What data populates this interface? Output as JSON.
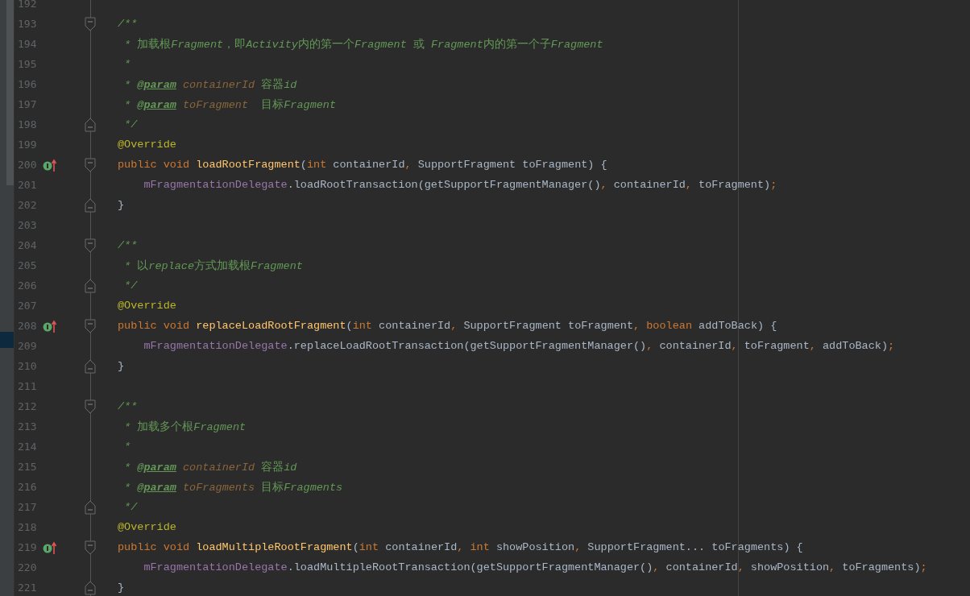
{
  "editor": {
    "lines": [
      {
        "number": "192",
        "fold_start": false,
        "fold_end": false,
        "override_marker": false
      },
      {
        "number": "193",
        "fold_start": true,
        "fold_end": false,
        "override_marker": false,
        "tokens": [
          {
            "text": "/**",
            "kind": "comment"
          }
        ]
      },
      {
        "number": "194",
        "fold_start": false,
        "fold_end": false,
        "override_marker": false,
        "tokens": [
          {
            "text": " * ",
            "kind": "comment"
          },
          {
            "text": "加载根",
            "kind": "cjk"
          },
          {
            "text": "Fragment",
            "kind": "comment"
          },
          {
            "text": "，即",
            "kind": "cjk"
          },
          {
            "text": "Activity",
            "kind": "comment"
          },
          {
            "text": "内的第一个",
            "kind": "cjk"
          },
          {
            "text": "Fragment",
            "kind": "comment"
          },
          {
            "text": " 或 ",
            "kind": "cjk"
          },
          {
            "text": "Fragment",
            "kind": "comment"
          },
          {
            "text": "内的第一个子",
            "kind": "cjk"
          },
          {
            "text": "Fragment",
            "kind": "comment"
          }
        ]
      },
      {
        "number": "195",
        "fold_start": false,
        "fold_end": false,
        "override_marker": false,
        "tokens": [
          {
            "text": " *",
            "kind": "comment"
          }
        ]
      },
      {
        "number": "196",
        "fold_start": false,
        "fold_end": false,
        "override_marker": false,
        "tokens": [
          {
            "text": " * ",
            "kind": "comment"
          },
          {
            "text": "@param",
            "kind": "tag"
          },
          {
            "text": " containerId ",
            "kind": "param"
          },
          {
            "text": "容器",
            "kind": "cjk"
          },
          {
            "text": "id",
            "kind": "comment"
          }
        ]
      },
      {
        "number": "197",
        "fold_start": false,
        "fold_end": false,
        "override_marker": false,
        "tokens": [
          {
            "text": " * ",
            "kind": "comment"
          },
          {
            "text": "@param",
            "kind": "tag"
          },
          {
            "text": " toFragment  ",
            "kind": "param"
          },
          {
            "text": "目标",
            "kind": "cjk"
          },
          {
            "text": "Fragment",
            "kind": "comment"
          }
        ]
      },
      {
        "number": "198",
        "fold_start": false,
        "fold_end": true,
        "override_marker": false,
        "tokens": [
          {
            "text": " */",
            "kind": "comment"
          }
        ]
      },
      {
        "number": "199",
        "fold_start": false,
        "fold_end": false,
        "override_marker": false,
        "tokens": [
          {
            "text": "@Override",
            "kind": "annotation"
          }
        ]
      },
      {
        "number": "200",
        "fold_start": true,
        "fold_end": false,
        "override_marker": true,
        "tokens": [
          {
            "text": "public void ",
            "kind": "keyword"
          },
          {
            "text": "loadRootFragment",
            "kind": "method"
          },
          {
            "text": "(",
            "kind": "plain"
          },
          {
            "text": "int",
            "kind": "keyword"
          },
          {
            "text": " containerId",
            "kind": "plain"
          },
          {
            "text": ",",
            "kind": "punct"
          },
          {
            "text": " SupportFragment toFragment) {",
            "kind": "plain"
          }
        ]
      },
      {
        "number": "201",
        "fold_start": false,
        "fold_end": false,
        "override_marker": false,
        "tokens": [
          {
            "text": "    mFragmentationDelegate",
            "kind": "field"
          },
          {
            "text": ".loadRootTransaction(getSupportFragmentManager()",
            "kind": "plain"
          },
          {
            "text": ",",
            "kind": "punct"
          },
          {
            "text": " containerId",
            "kind": "plain"
          },
          {
            "text": ",",
            "kind": "punct"
          },
          {
            "text": " toFragment)",
            "kind": "plain"
          },
          {
            "text": ";",
            "kind": "punct"
          }
        ]
      },
      {
        "number": "202",
        "fold_start": false,
        "fold_end": true,
        "override_marker": false,
        "tokens": [
          {
            "text": "}",
            "kind": "plain"
          }
        ]
      },
      {
        "number": "203",
        "fold_start": false,
        "fold_end": false,
        "override_marker": false
      },
      {
        "number": "204",
        "fold_start": true,
        "fold_end": false,
        "override_marker": false,
        "tokens": [
          {
            "text": "/**",
            "kind": "comment"
          }
        ]
      },
      {
        "number": "205",
        "fold_start": false,
        "fold_end": false,
        "override_marker": false,
        "tokens": [
          {
            "text": " * ",
            "kind": "comment"
          },
          {
            "text": "以",
            "kind": "cjk"
          },
          {
            "text": "replace",
            "kind": "comment"
          },
          {
            "text": "方式加载根",
            "kind": "cjk"
          },
          {
            "text": "Fragment",
            "kind": "comment"
          }
        ]
      },
      {
        "number": "206",
        "fold_start": false,
        "fold_end": true,
        "override_marker": false,
        "tokens": [
          {
            "text": " */",
            "kind": "comment"
          }
        ]
      },
      {
        "number": "207",
        "fold_start": false,
        "fold_end": false,
        "override_marker": false,
        "tokens": [
          {
            "text": "@Override",
            "kind": "annotation"
          }
        ]
      },
      {
        "number": "208",
        "fold_start": true,
        "fold_end": false,
        "override_marker": true,
        "tokens": [
          {
            "text": "public void ",
            "kind": "keyword"
          },
          {
            "text": "replaceLoadRootFragment",
            "kind": "method"
          },
          {
            "text": "(",
            "kind": "plain"
          },
          {
            "text": "int",
            "kind": "keyword"
          },
          {
            "text": " containerId",
            "kind": "plain"
          },
          {
            "text": ",",
            "kind": "punct"
          },
          {
            "text": " SupportFragment toFragment",
            "kind": "plain"
          },
          {
            "text": ",",
            "kind": "punct"
          },
          {
            "text": " boolean",
            "kind": "keyword"
          },
          {
            "text": " addToBack) {",
            "kind": "plain"
          }
        ]
      },
      {
        "number": "209",
        "fold_start": false,
        "fold_end": false,
        "override_marker": false,
        "tokens": [
          {
            "text": "    mFragmentationDelegate",
            "kind": "field"
          },
          {
            "text": ".replaceLoadRootTransaction(getSupportFragmentManager()",
            "kind": "plain"
          },
          {
            "text": ",",
            "kind": "punct"
          },
          {
            "text": " containerId",
            "kind": "plain"
          },
          {
            "text": ",",
            "kind": "punct"
          },
          {
            "text": " toFragment",
            "kind": "plain"
          },
          {
            "text": ",",
            "kind": "punct"
          },
          {
            "text": " addToBack)",
            "kind": "plain"
          },
          {
            "text": ";",
            "kind": "punct"
          }
        ]
      },
      {
        "number": "210",
        "fold_start": false,
        "fold_end": true,
        "override_marker": false,
        "tokens": [
          {
            "text": "}",
            "kind": "plain"
          }
        ]
      },
      {
        "number": "211",
        "fold_start": false,
        "fold_end": false,
        "override_marker": false
      },
      {
        "number": "212",
        "fold_start": true,
        "fold_end": false,
        "override_marker": false,
        "tokens": [
          {
            "text": "/**",
            "kind": "comment"
          }
        ]
      },
      {
        "number": "213",
        "fold_start": false,
        "fold_end": false,
        "override_marker": false,
        "tokens": [
          {
            "text": " * ",
            "kind": "comment"
          },
          {
            "text": "加载多个根",
            "kind": "cjk"
          },
          {
            "text": "Fragment",
            "kind": "comment"
          }
        ]
      },
      {
        "number": "214",
        "fold_start": false,
        "fold_end": false,
        "override_marker": false,
        "tokens": [
          {
            "text": " *",
            "kind": "comment"
          }
        ]
      },
      {
        "number": "215",
        "fold_start": false,
        "fold_end": false,
        "override_marker": false,
        "tokens": [
          {
            "text": " * ",
            "kind": "comment"
          },
          {
            "text": "@param",
            "kind": "tag"
          },
          {
            "text": " containerId ",
            "kind": "param"
          },
          {
            "text": "容器",
            "kind": "cjk"
          },
          {
            "text": "id",
            "kind": "comment"
          }
        ]
      },
      {
        "number": "216",
        "fold_start": false,
        "fold_end": false,
        "override_marker": false,
        "tokens": [
          {
            "text": " * ",
            "kind": "comment"
          },
          {
            "text": "@param",
            "kind": "tag"
          },
          {
            "text": " toFragments ",
            "kind": "param"
          },
          {
            "text": "目标",
            "kind": "cjk"
          },
          {
            "text": "Fragments",
            "kind": "comment"
          }
        ]
      },
      {
        "number": "217",
        "fold_start": false,
        "fold_end": true,
        "override_marker": false,
        "tokens": [
          {
            "text": " */",
            "kind": "comment"
          }
        ]
      },
      {
        "number": "218",
        "fold_start": false,
        "fold_end": false,
        "override_marker": false,
        "tokens": [
          {
            "text": "@Override",
            "kind": "annotation"
          }
        ]
      },
      {
        "number": "219",
        "fold_start": true,
        "fold_end": false,
        "override_marker": true,
        "tokens": [
          {
            "text": "public void ",
            "kind": "keyword"
          },
          {
            "text": "loadMultipleRootFragment",
            "kind": "method"
          },
          {
            "text": "(",
            "kind": "plain"
          },
          {
            "text": "int",
            "kind": "keyword"
          },
          {
            "text": " containerId",
            "kind": "plain"
          },
          {
            "text": ",",
            "kind": "punct"
          },
          {
            "text": " int",
            "kind": "keyword"
          },
          {
            "text": " showPosition",
            "kind": "plain"
          },
          {
            "text": ",",
            "kind": "punct"
          },
          {
            "text": " SupportFragment... toFragments) {",
            "kind": "plain"
          }
        ]
      },
      {
        "number": "220",
        "fold_start": false,
        "fold_end": false,
        "override_marker": false,
        "tokens": [
          {
            "text": "    mFragmentationDelegate",
            "kind": "field"
          },
          {
            "text": ".loadMultipleRootTransaction(getSupportFragmentManager()",
            "kind": "plain"
          },
          {
            "text": ",",
            "kind": "punct"
          },
          {
            "text": " containerId",
            "kind": "plain"
          },
          {
            "text": ",",
            "kind": "punct"
          },
          {
            "text": " showPosition",
            "kind": "plain"
          },
          {
            "text": ",",
            "kind": "punct"
          },
          {
            "text": " toFragments)",
            "kind": "plain"
          },
          {
            "text": ";",
            "kind": "punct"
          }
        ]
      },
      {
        "number": "221",
        "fold_start": false,
        "fold_end": true,
        "override_marker": false,
        "tokens": [
          {
            "text": "}",
            "kind": "plain"
          }
        ]
      }
    ]
  }
}
